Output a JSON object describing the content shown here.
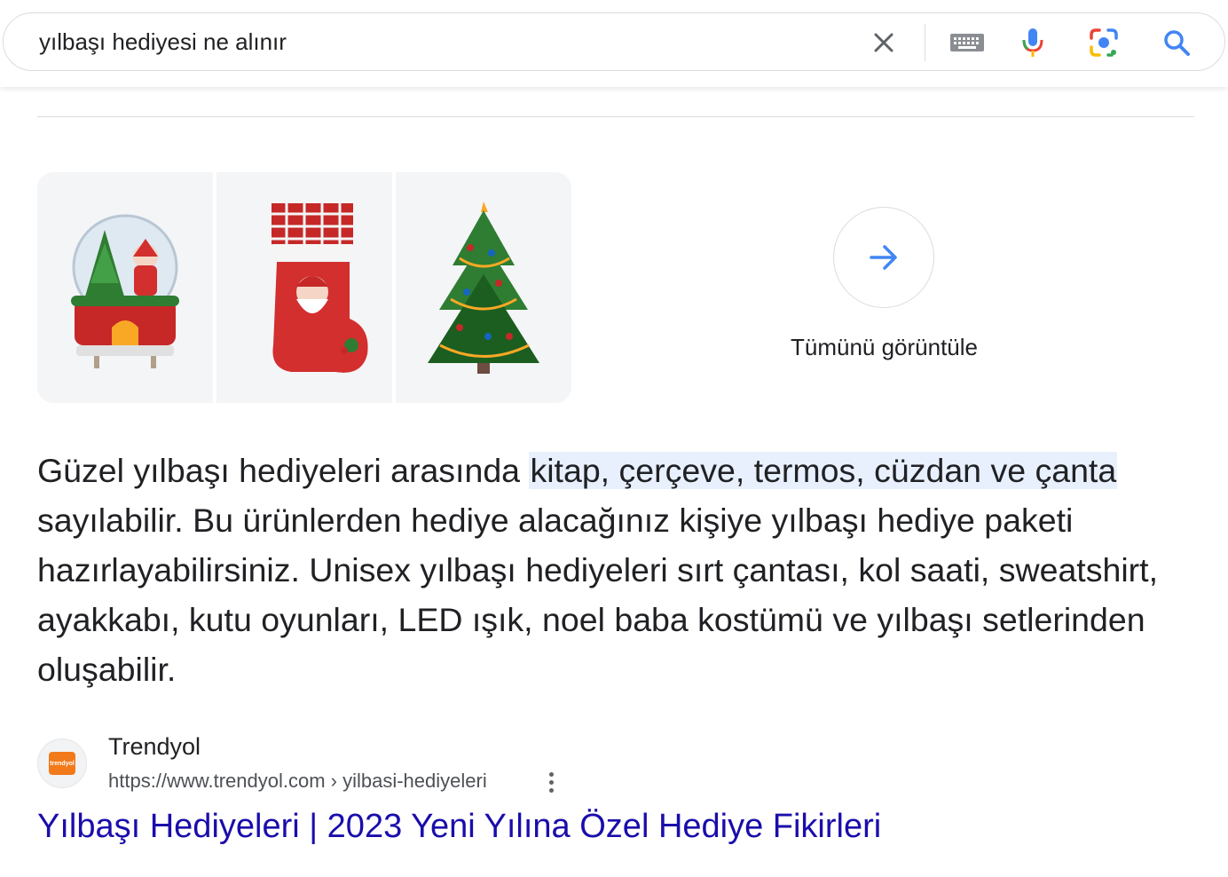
{
  "search": {
    "query": "yılbaşı hediyesi ne alınır"
  },
  "icons": {
    "clear": "close-icon",
    "keyboard": "keyboard-icon",
    "voice": "microphone-icon",
    "lens": "camera-lens-icon",
    "search": "search-icon"
  },
  "images": [
    {
      "name": "snow-globe-image"
    },
    {
      "name": "christmas-stocking-image"
    },
    {
      "name": "christmas-tree-image"
    }
  ],
  "view_all": {
    "label": "Tümünü görüntüle"
  },
  "snippet": {
    "before": "Güzel yılbaşı hediyeleri arasında ",
    "highlight": "kitap, çerçeve, termos, cüzdan ve çanta",
    "after": " sayılabilir. Bu ürünlerden hediye alacağınız kişiye yılbaşı hediye paketi hazırlayabilirsiniz. Unisex yılbaşı hediyeleri sırt çantası, kol saati, sweatshirt, ayakkabı, kutu oyunları, LED ışık, noel baba kostümü ve yılbaşı setlerinden oluşabilir."
  },
  "result": {
    "site_name": "Trendyol",
    "favicon_text": "trendyol",
    "url": "https://www.trendyol.com › yilbasi-hediyeleri",
    "title": "Yılbaşı Hediyeleri | 2023 Yeni Yılına Özel Hediye Fikirleri"
  },
  "colors": {
    "link": "#1a0dab",
    "highlight": "#e8f0fe",
    "accent": "#4285f4"
  }
}
